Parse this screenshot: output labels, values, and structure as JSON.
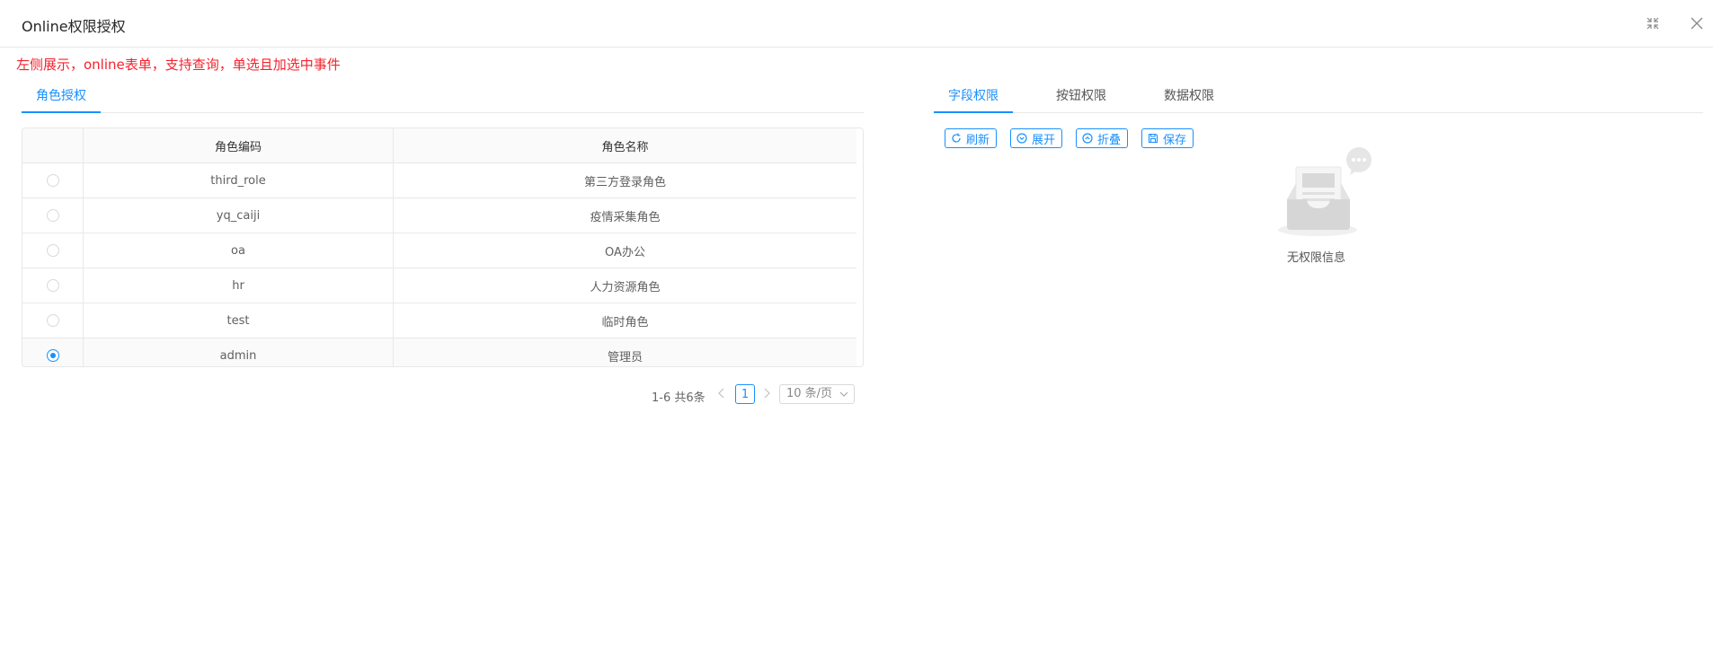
{
  "header": {
    "title": "Online权限授权",
    "fullscreen_icon": "compress-icon",
    "close_icon": "close-icon"
  },
  "notice": "左侧展示，online表单，支持查询，单选且加选中事件",
  "left": {
    "tabs": [
      {
        "label": "角色授权",
        "active": true
      }
    ],
    "table": {
      "columns": [
        "",
        "角色编码",
        "角色名称"
      ],
      "rows": [
        {
          "code": "third_role",
          "name": "第三方登录角色",
          "selected": false
        },
        {
          "code": "yq_caiji",
          "name": "疫情采集角色",
          "selected": false
        },
        {
          "code": "oa",
          "name": "OA办公",
          "selected": false
        },
        {
          "code": "hr",
          "name": "人力资源角色",
          "selected": false
        },
        {
          "code": "test",
          "name": "临时角色",
          "selected": false
        },
        {
          "code": "admin",
          "name": "管理员",
          "selected": true
        }
      ]
    },
    "pagination": {
      "total_text": "1-6 共6条",
      "current_page": "1",
      "page_size": "10 条/页",
      "prev_icon": "chevron-left-icon",
      "next_icon": "chevron-right-icon"
    }
  },
  "right": {
    "tabs": [
      {
        "label": "字段权限",
        "active": true
      },
      {
        "label": "按钮权限",
        "active": false
      },
      {
        "label": "数据权限",
        "active": false
      }
    ],
    "buttons": [
      {
        "label": "刷新",
        "icon": "refresh-icon"
      },
      {
        "label": "展开",
        "icon": "expand-icon"
      },
      {
        "label": "折叠",
        "icon": "collapse-icon"
      },
      {
        "label": "保存",
        "icon": "save-icon"
      }
    ],
    "empty_text": "无权限信息",
    "empty_icon": "empty-inbox-icon"
  },
  "colors": {
    "primary": "#1890ff",
    "notice": "#f5222d",
    "border": "#e8e8e8"
  }
}
